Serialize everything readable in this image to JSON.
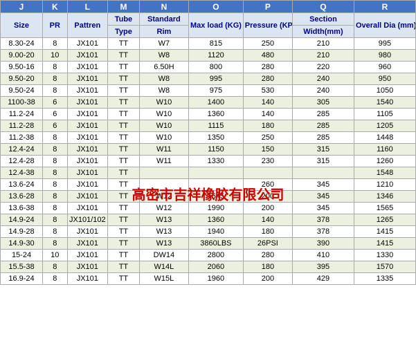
{
  "columns": {
    "j": "J",
    "k": "K",
    "l": "L",
    "m": "M",
    "n": "N",
    "o": "O",
    "p": "P",
    "q": "Q",
    "r": "R"
  },
  "headers": {
    "row1": [
      "J",
      "K",
      "L",
      "M",
      "N",
      "O",
      "P",
      "Q",
      "R"
    ],
    "row2": [
      "Size",
      "PR",
      "Pattren",
      "Tube Type",
      "Standard Rim",
      "Max load (KG)",
      "Pressure (KPa)",
      "Section Width(mm)",
      "Overall Dia (mm)"
    ],
    "row2_m1": "Tube",
    "row2_m2": "Type",
    "row2_n1": "Standard",
    "row2_n2": "Rim",
    "row2_o": "Max load (KG)",
    "row2_p": "Pressure (KPa)",
    "row2_q1": "Section",
    "row2_q2": "Width(mm)",
    "row2_r": "Overall Dia (mm)"
  },
  "rows": [
    [
      "8.30-24",
      "8",
      "JX101",
      "TT",
      "W7",
      "815",
      "250",
      "210",
      "995"
    ],
    [
      "9.00-20",
      "10",
      "JX101",
      "TT",
      "W8",
      "1120",
      "480",
      "210",
      "980"
    ],
    [
      "9.50-16",
      "8",
      "JX101",
      "TT",
      "6.50H",
      "800",
      "280",
      "220",
      "960"
    ],
    [
      "9.50-20",
      "8",
      "JX101",
      "TT",
      "W8",
      "995",
      "280",
      "240",
      "950"
    ],
    [
      "9.50-24",
      "8",
      "JX101",
      "TT",
      "W8",
      "975",
      "530",
      "240",
      "1050"
    ],
    [
      "1100-38",
      "6",
      "JX101",
      "TT",
      "W10",
      "1400",
      "140",
      "305",
      "1540"
    ],
    [
      "11.2-24",
      "6",
      "JX101",
      "TT",
      "W10",
      "1360",
      "140",
      "285",
      "1105"
    ],
    [
      "11.2-28",
      "6",
      "JX101",
      "TT",
      "W10",
      "1115",
      "180",
      "285",
      "1205"
    ],
    [
      "11.2-38",
      "8",
      "JX101",
      "TT",
      "W10",
      "1350",
      "250",
      "285",
      "1448"
    ],
    [
      "12.4-24",
      "8",
      "JX101",
      "TT",
      "W11",
      "1150",
      "150",
      "315",
      "1160"
    ],
    [
      "12.4-28",
      "8",
      "JX101",
      "TT",
      "W11",
      "1330",
      "230",
      "315",
      "1260"
    ],
    [
      "12.4-38",
      "8",
      "JX101",
      "TT",
      "",
      "",
      "",
      "",
      "1548"
    ],
    [
      "13.6-24",
      "8",
      "JX101",
      "TT",
      "",
      "",
      "260",
      "345",
      "1210"
    ],
    [
      "13.6-28",
      "8",
      "JX101",
      "TT",
      "W12",
      "1645",
      "200",
      "345",
      "1346"
    ],
    [
      "13.6-38",
      "8",
      "JX101",
      "TT",
      "W12",
      "1990",
      "200",
      "345",
      "1565"
    ],
    [
      "14.9-24",
      "8",
      "JX101/102",
      "TT",
      "W13",
      "1360",
      "140",
      "378",
      "1265"
    ],
    [
      "14.9-28",
      "8",
      "JX101",
      "TT",
      "W13",
      "1940",
      "180",
      "378",
      "1415"
    ],
    [
      "14.9-30",
      "8",
      "JX101",
      "TT",
      "W13",
      "3860LBS",
      "26PSI",
      "390",
      "1415"
    ],
    [
      "15-24",
      "10",
      "JX101",
      "TT",
      "DW14",
      "2800",
      "280",
      "410",
      "1330"
    ],
    [
      "15.5-38",
      "8",
      "JX101",
      "TT",
      "W14L",
      "2060",
      "180",
      "395",
      "1570"
    ],
    [
      "16.9-24",
      "8",
      "JX101",
      "TT",
      "W15L",
      "1960",
      "200",
      "429",
      "1335"
    ]
  ],
  "watermark": "高密市吉祥橡胶有限公司"
}
